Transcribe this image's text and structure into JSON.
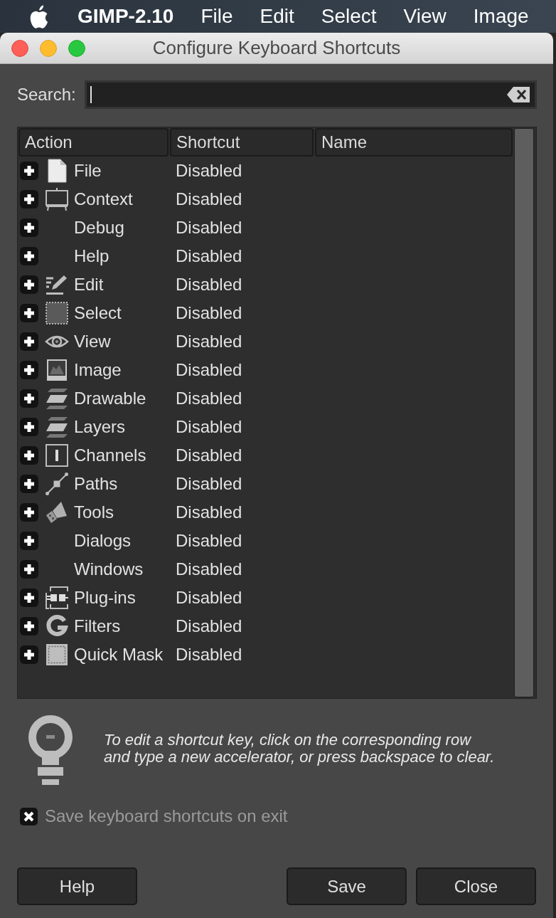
{
  "menubar": {
    "app_name": "GIMP-2.10",
    "items": [
      "File",
      "Edit",
      "Select",
      "View",
      "Image"
    ]
  },
  "window": {
    "title": "Configure Keyboard Shortcuts"
  },
  "search": {
    "label": "Search:"
  },
  "tree": {
    "columns": [
      "Action",
      "Shortcut",
      "Name"
    ],
    "rows": [
      {
        "action": "File",
        "shortcut": "Disabled",
        "expanded": false
      },
      {
        "action": "Context",
        "shortcut": "Disabled",
        "expanded": false
      },
      {
        "action": "Debug",
        "shortcut": "Disabled",
        "expanded": false
      },
      {
        "action": "Help",
        "shortcut": "Disabled",
        "expanded": false
      },
      {
        "action": "Edit",
        "shortcut": "Disabled",
        "expanded": false
      },
      {
        "action": "Select",
        "shortcut": "Disabled",
        "expanded": false
      },
      {
        "action": "View",
        "shortcut": "Disabled",
        "expanded": false
      },
      {
        "action": "Image",
        "shortcut": "Disabled",
        "expanded": false
      },
      {
        "action": "Drawable",
        "shortcut": "Disabled",
        "expanded": false
      },
      {
        "action": "Layers",
        "shortcut": "Disabled",
        "expanded": false
      },
      {
        "action": "Channels",
        "shortcut": "Disabled",
        "expanded": false
      },
      {
        "action": "Paths",
        "shortcut": "Disabled",
        "expanded": false
      },
      {
        "action": "Tools",
        "shortcut": "Disabled",
        "expanded": false
      },
      {
        "action": "Dialogs",
        "shortcut": "Disabled",
        "expanded": false
      },
      {
        "action": "Windows",
        "shortcut": "Disabled",
        "expanded": false
      },
      {
        "action": "Plug-ins",
        "shortcut": "Disabled",
        "expanded": false
      },
      {
        "action": "Filters",
        "shortcut": "Disabled",
        "expanded": false
      },
      {
        "action": "Quick Mask",
        "shortcut": "Disabled",
        "expanded": false
      }
    ]
  },
  "hint": {
    "text": "To edit a shortcut key, click on the corresponding row and type a new accelerator, or press backspace to clear."
  },
  "checkbox": {
    "label": "Save keyboard shortcuts on exit",
    "checked": true
  },
  "buttons": [
    "Help",
    "Save",
    "Close"
  ]
}
